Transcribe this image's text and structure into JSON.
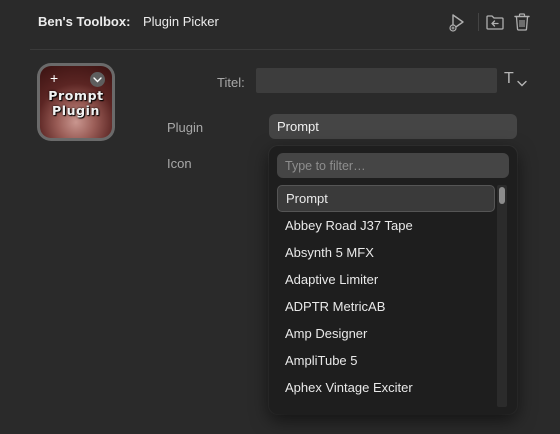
{
  "header": {
    "title_bold": "Ben's Toolbox:",
    "title_name": "Plugin Picker",
    "icons": [
      "run-icon",
      "import-icon",
      "trash-icon"
    ]
  },
  "thumbnail": {
    "text_line1": "Prompt",
    "text_line2": "Plugin",
    "plus": "+"
  },
  "form": {
    "title_label": "Titel:",
    "title_value": "",
    "title_type_glyph": "T",
    "plugin_label": "Plugin",
    "plugin_value": "Prompt",
    "icon_label": "Icon"
  },
  "popup": {
    "filter_placeholder": "Type to filter…",
    "items": [
      "Prompt",
      "Abbey Road J37 Tape",
      "Absynth 5 MFX",
      "Adaptive Limiter",
      "ADPTR MetricAB",
      "Amp Designer",
      "AmpliTube 5",
      "Aphex Vintage Exciter"
    ],
    "selected_index": 0
  },
  "colors": {
    "background": "#2a2a2a",
    "popup_bg": "#1e1e1e",
    "field_bg": "#454545",
    "label": "#a8a8a8"
  }
}
